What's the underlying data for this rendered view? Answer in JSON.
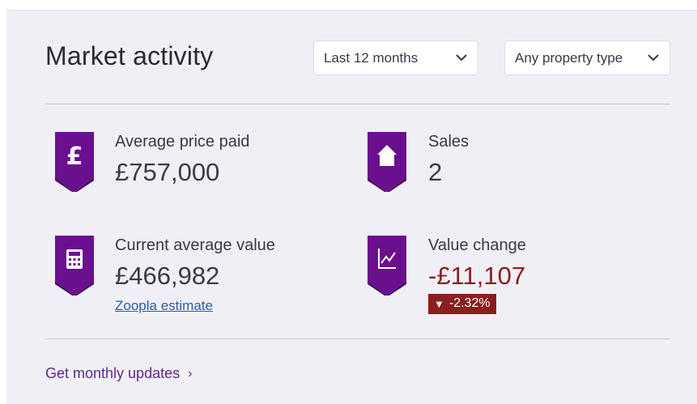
{
  "header": {
    "title": "Market activity"
  },
  "filters": {
    "period": {
      "value": "Last 12 months",
      "icon": "chevron-down-icon"
    },
    "property_type": {
      "value": "Any property type",
      "icon": "chevron-down-icon"
    }
  },
  "stats": {
    "average_price": {
      "label": "Average price paid",
      "value": "£757,000",
      "icon": "pound-icon"
    },
    "sales": {
      "label": "Sales",
      "value": "2",
      "icon": "house-icon"
    },
    "current_value": {
      "label": "Current average value",
      "value": "£466,982",
      "link": "Zoopla estimate",
      "icon": "calculator-icon"
    },
    "value_change": {
      "label": "Value change",
      "value": "-£11,107",
      "change": "-2.32%",
      "change_arrow": "▼",
      "icon": "line-chart-icon"
    }
  },
  "footer": {
    "link": "Get monthly updates",
    "arrow": "›"
  },
  "colors": {
    "badge": "#6a0f8e",
    "badge_dark": "#4a0a66",
    "negative": "#8b1e1e",
    "panel": "#f0eff6",
    "link": "#2b5ea3"
  }
}
